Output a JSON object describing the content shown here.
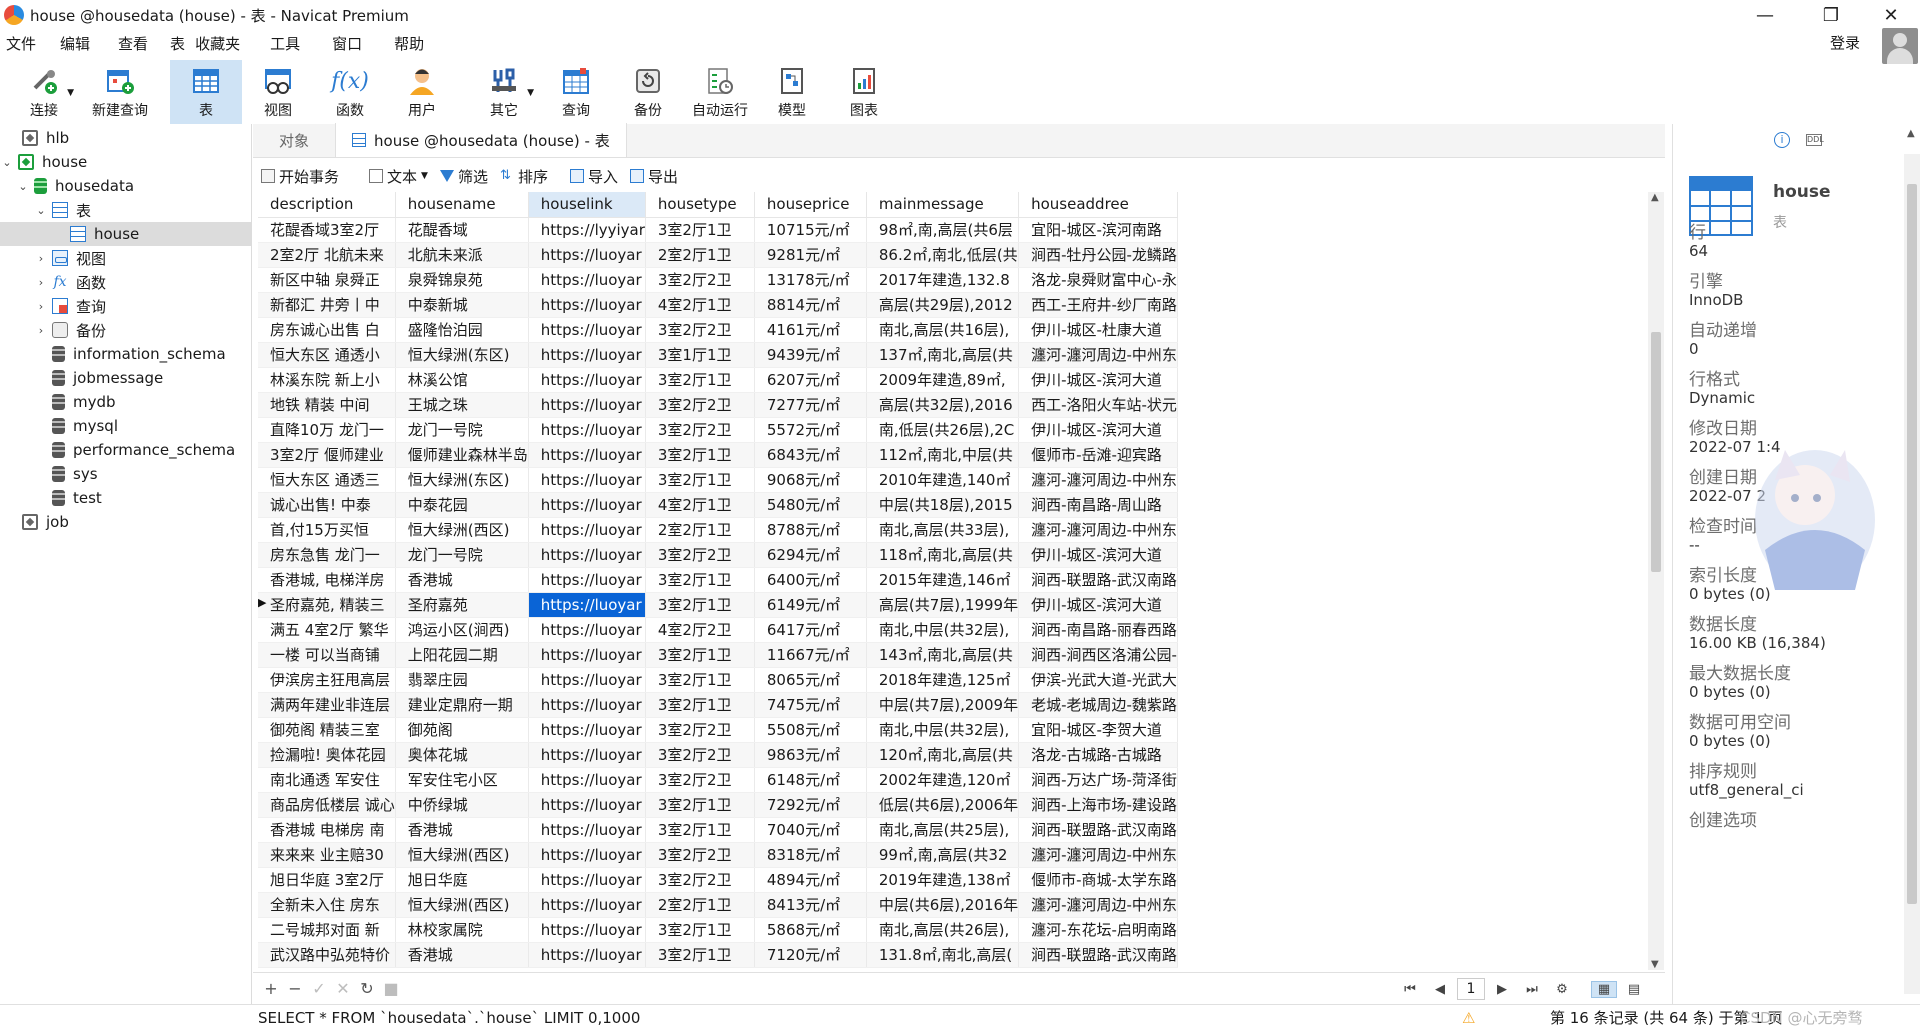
{
  "window": {
    "title": "house @housedata (house) - 表 - Navicat Premium"
  },
  "menu": [
    "文件",
    "编辑",
    "查看",
    "表",
    "收藏夹",
    "工具",
    "窗口",
    "帮助"
  ],
  "login": "登录",
  "toolbar": [
    {
      "label": "连接",
      "icon": "connect-icon"
    },
    {
      "label": "新建查询",
      "icon": "new-query-icon"
    },
    {
      "label": "表",
      "icon": "table-icon"
    },
    {
      "label": "视图",
      "icon": "view-icon"
    },
    {
      "label": "函数",
      "icon": "function-icon"
    },
    {
      "label": "用户",
      "icon": "user-icon"
    },
    {
      "label": "其它",
      "icon": "tools-icon"
    },
    {
      "label": "查询",
      "icon": "query-icon"
    },
    {
      "label": "备份",
      "icon": "backup-icon"
    },
    {
      "label": "自动运行",
      "icon": "automation-icon"
    },
    {
      "label": "模型",
      "icon": "model-icon"
    },
    {
      "label": "图表",
      "icon": "chart-icon"
    }
  ],
  "tree": {
    "hlb": "hlb",
    "house": "house",
    "housedata": "housedata",
    "tables": "表",
    "house_table": "house",
    "views": "视图",
    "functions": "函数",
    "queries": "查询",
    "backups": "备份",
    "information_schema": "information_schema",
    "jobmessage": "jobmessage",
    "mydb": "mydb",
    "mysql": "mysql",
    "performance_schema": "performance_schema",
    "sys": "sys",
    "test": "test",
    "job": "job"
  },
  "tabs": {
    "objects": "对象",
    "active": "house @housedata (house) - 表"
  },
  "actions": {
    "begin": "开始事务",
    "text": "文本",
    "filter": "筛选",
    "sort": "排序",
    "import": "导入",
    "export": "导出"
  },
  "grid": {
    "columns": [
      "description",
      "housename",
      "houselink",
      "housetype",
      "houseprice",
      "mainmessage",
      "houseaddree"
    ],
    "rows": [
      [
        "花醍香域3室2厅",
        "花醍香域",
        "https://lyyiyar",
        "3室2厅1卫",
        "10715元/㎡",
        "98㎡,南,高层(共6层",
        "宜阳-城区-滨河南路"
      ],
      [
        "2室2厅 北航未来",
        "北航未来派",
        "https://luoyar",
        "2室2厅1卫",
        "9281元/㎡",
        "86.2㎡,南北,低层(共",
        "涧西-牡丹公园-龙鳞路"
      ],
      [
        "新区中轴 泉舜正",
        "泉舜锦泉苑",
        "https://luoyar",
        "3室2厅2卫",
        "13178元/㎡",
        "2017年建造,132.8",
        "洛龙-泉舜财富中心-永"
      ],
      [
        "新都汇  井旁丨中",
        "中泰新城",
        "https://luoyar",
        "4室2厅1卫",
        "8814元/㎡",
        "高层(共29层),2012",
        "西工-王府井-纱厂南路"
      ],
      [
        "房东诚心出售 白",
        "盛隆怡泊园",
        "https://luoyar",
        "3室2厅2卫",
        "4161元/㎡",
        "南北,高层(共16层),",
        "伊川-城区-杜康大道"
      ],
      [
        "恒大东区 通透小",
        "恒大绿洲(东区)",
        "https://luoyar",
        "3室1厅1卫",
        "9439元/㎡",
        "137㎡,南北,高层(共",
        "瀍河-瀍河周边-中州东"
      ],
      [
        "林溪东院 新上小",
        "林溪公馆",
        "https://luoyar",
        "3室2厅1卫",
        "6207元/㎡",
        "2009年建造,89㎡,",
        "伊川-城区-滨河大道"
      ],
      [
        "地铁 精装  中间",
        "王城之珠",
        "https://luoyar",
        "3室2厅2卫",
        "7277元/㎡",
        "高层(共32层),2016",
        "西工-洛阳火车站-状元"
      ],
      [
        "直降10万  龙门一",
        "龙门一号院",
        "https://luoyar",
        "3室2厅2卫",
        "5572元/㎡",
        "南,低层(共26层),2C",
        "伊川-城区-滨河大道"
      ],
      [
        "3室2厅  偃师建业",
        "偃师建业森林半岛",
        "https://luoyar",
        "3室2厅1卫",
        "6843元/㎡",
        "112㎡,南北,中层(共",
        "偃师市-岳滩-迎宾路"
      ],
      [
        "恒大东区 通透三",
        "恒大绿洲(东区)",
        "https://luoyar",
        "3室2厅1卫",
        "9068元/㎡",
        "2010年建造,140㎡",
        "瀍河-瀍河周边-中州东"
      ],
      [
        "诚心出售!  中泰",
        "中泰花园",
        "https://luoyar",
        "4室2厅1卫",
        "5480元/㎡",
        "中层(共18层),2015",
        "涧西-南昌路-周山路"
      ],
      [
        "首,付15万买恒",
        "恒大绿洲(西区)",
        "https://luoyar",
        "2室2厅1卫",
        "8788元/㎡",
        "南北,高层(共33层),",
        "瀍河-瀍河周边-中州东"
      ],
      [
        "房东急售 龙门一",
        "龙门一号院",
        "https://luoyar",
        "3室2厅2卫",
        "6294元/㎡",
        "118㎡,南北,高层(共",
        "伊川-城区-滨河大道"
      ],
      [
        "香港城,  电梯洋房",
        "香港城",
        "https://luoyar",
        "3室2厅1卫",
        "6400元/㎡",
        "2015年建造,146㎡",
        "涧西-联盟路-武汉南路"
      ],
      [
        "圣府嘉苑,  精装三",
        "圣府嘉苑",
        "https://luoyar",
        "3室2厅1卫",
        "6149元/㎡",
        "高层(共7层),1999年",
        "伊川-城区-滨河大道"
      ],
      [
        "满五 4室2厅 繁华",
        "鸿运小区(涧西)",
        "https://luoyar",
        "4室2厅2卫",
        "6417元/㎡",
        "南北,中层(共32层),",
        "涧西-南昌路-丽春西路"
      ],
      [
        "一楼 可以当商铺",
        "上阳花园二期",
        "https://luoyar",
        "3室2厅1卫",
        "11667元/㎡",
        "143㎡,南北,高层(共",
        "涧西-涧西区洛浦公园-"
      ],
      [
        "伊滨房主狂甩高层",
        "翡翠庄园",
        "https://luoyar",
        "3室2厅1卫",
        "8065元/㎡",
        "2018年建造,125㎡",
        "伊滨-光武大道-光武大"
      ],
      [
        "满两年建业非连层",
        "建业定鼎府一期",
        "https://luoyar",
        "3室2厅1卫",
        "7475元/㎡",
        "中层(共7层),2009年",
        "老城-老城周边-魏紫路"
      ],
      [
        "御苑阁 精装三室",
        "御苑阁",
        "https://luoyar",
        "3室2厅2卫",
        "5508元/㎡",
        "南北,中层(共32层),",
        "宜阳-城区-李贺大道"
      ],
      [
        "捡漏啦!  奥体花园",
        "奥体花城",
        "https://luoyar",
        "3室2厅2卫",
        "9863元/㎡",
        "120㎡,南北,高层(共",
        "洛龙-古城路-古城路"
      ],
      [
        "南北通透 军安住",
        "军安住宅小区",
        "https://luoyar",
        "3室2厅2卫",
        "6148元/㎡",
        "2002年建造,120㎡",
        "涧西-万达广场-菏泽街"
      ],
      [
        "商品房低楼层 诚心",
        "中侨绿城",
        "https://luoyar",
        "3室2厅1卫",
        "7292元/㎡",
        "低层(共6层),2006年",
        "涧西-上海市场-建设路"
      ],
      [
        "香港城 电梯房 南",
        "香港城",
        "https://luoyar",
        "3室2厅1卫",
        "7040元/㎡",
        "南北,高层(共25层),",
        "涧西-联盟路-武汉南路"
      ],
      [
        "来来来 业主赔30",
        "恒大绿洲(西区)",
        "https://luoyar",
        "3室2厅2卫",
        "8318元/㎡",
        "99㎡,南,高层(共32",
        "瀍河-瀍河周边-中州东"
      ],
      [
        "旭日华庭 3室2厅",
        "旭日华庭",
        "https://luoyar",
        "3室2厅2卫",
        "4894元/㎡",
        "2019年建造,138㎡",
        "偃师市-商城-太学东路"
      ],
      [
        "全新未入住 房东",
        "恒大绿洲(西区)",
        "https://luoyar",
        "2室2厅1卫",
        "8413元/㎡",
        "中层(共6层),2016年",
        "瀍河-瀍河周边-中州东"
      ],
      [
        "二号城邦对面 新",
        "林校家属院",
        "https://luoyar",
        "3室2厅1卫",
        "5868元/㎡",
        "南北,高层(共26层),",
        "瀍河-东花坛-启明南路"
      ],
      [
        "武汉路中弘苑特价",
        "香港城",
        "https://luoyar",
        "3室2厅1卫",
        "7120元/㎡",
        "131.8㎡,南北,高层(",
        "涧西-联盟路-武汉南路"
      ]
    ],
    "selected_row": 15,
    "selected_col": 2
  },
  "bottom_tools": [
    "+",
    "−",
    "✓",
    "✕",
    "↻",
    "■"
  ],
  "pager": {
    "page": "1"
  },
  "status": {
    "sql": "SELECT * FROM `housedata`.`house` LIMIT 0,1000",
    "record": "第 16 条记录 (共 64 条) 于第 1 页",
    "watermark": "CSDN @心无旁骛"
  },
  "info": {
    "name": "house",
    "type": "表",
    "fields": [
      {
        "label": "行",
        "value": "64"
      },
      {
        "label": "引擎",
        "value": "InnoDB"
      },
      {
        "label": "自动递增",
        "value": "0"
      },
      {
        "label": "行格式",
        "value": "Dynamic"
      },
      {
        "label": "修改日期",
        "value": "2022-07 1:4"
      },
      {
        "label": "创建日期",
        "value": "2022-07 2"
      },
      {
        "label": "检查时间",
        "value": "--"
      },
      {
        "label": "索引长度",
        "value": "0 bytes (0)"
      },
      {
        "label": "数据长度",
        "value": "16.00 KB (16,384)"
      },
      {
        "label": "最大数据长度",
        "value": "0 bytes (0)"
      },
      {
        "label": "数据可用空间",
        "value": "0 bytes (0)"
      },
      {
        "label": "排序规则",
        "value": "utf8_general_ci"
      },
      {
        "label": "创建选项",
        "value": ""
      }
    ]
  }
}
